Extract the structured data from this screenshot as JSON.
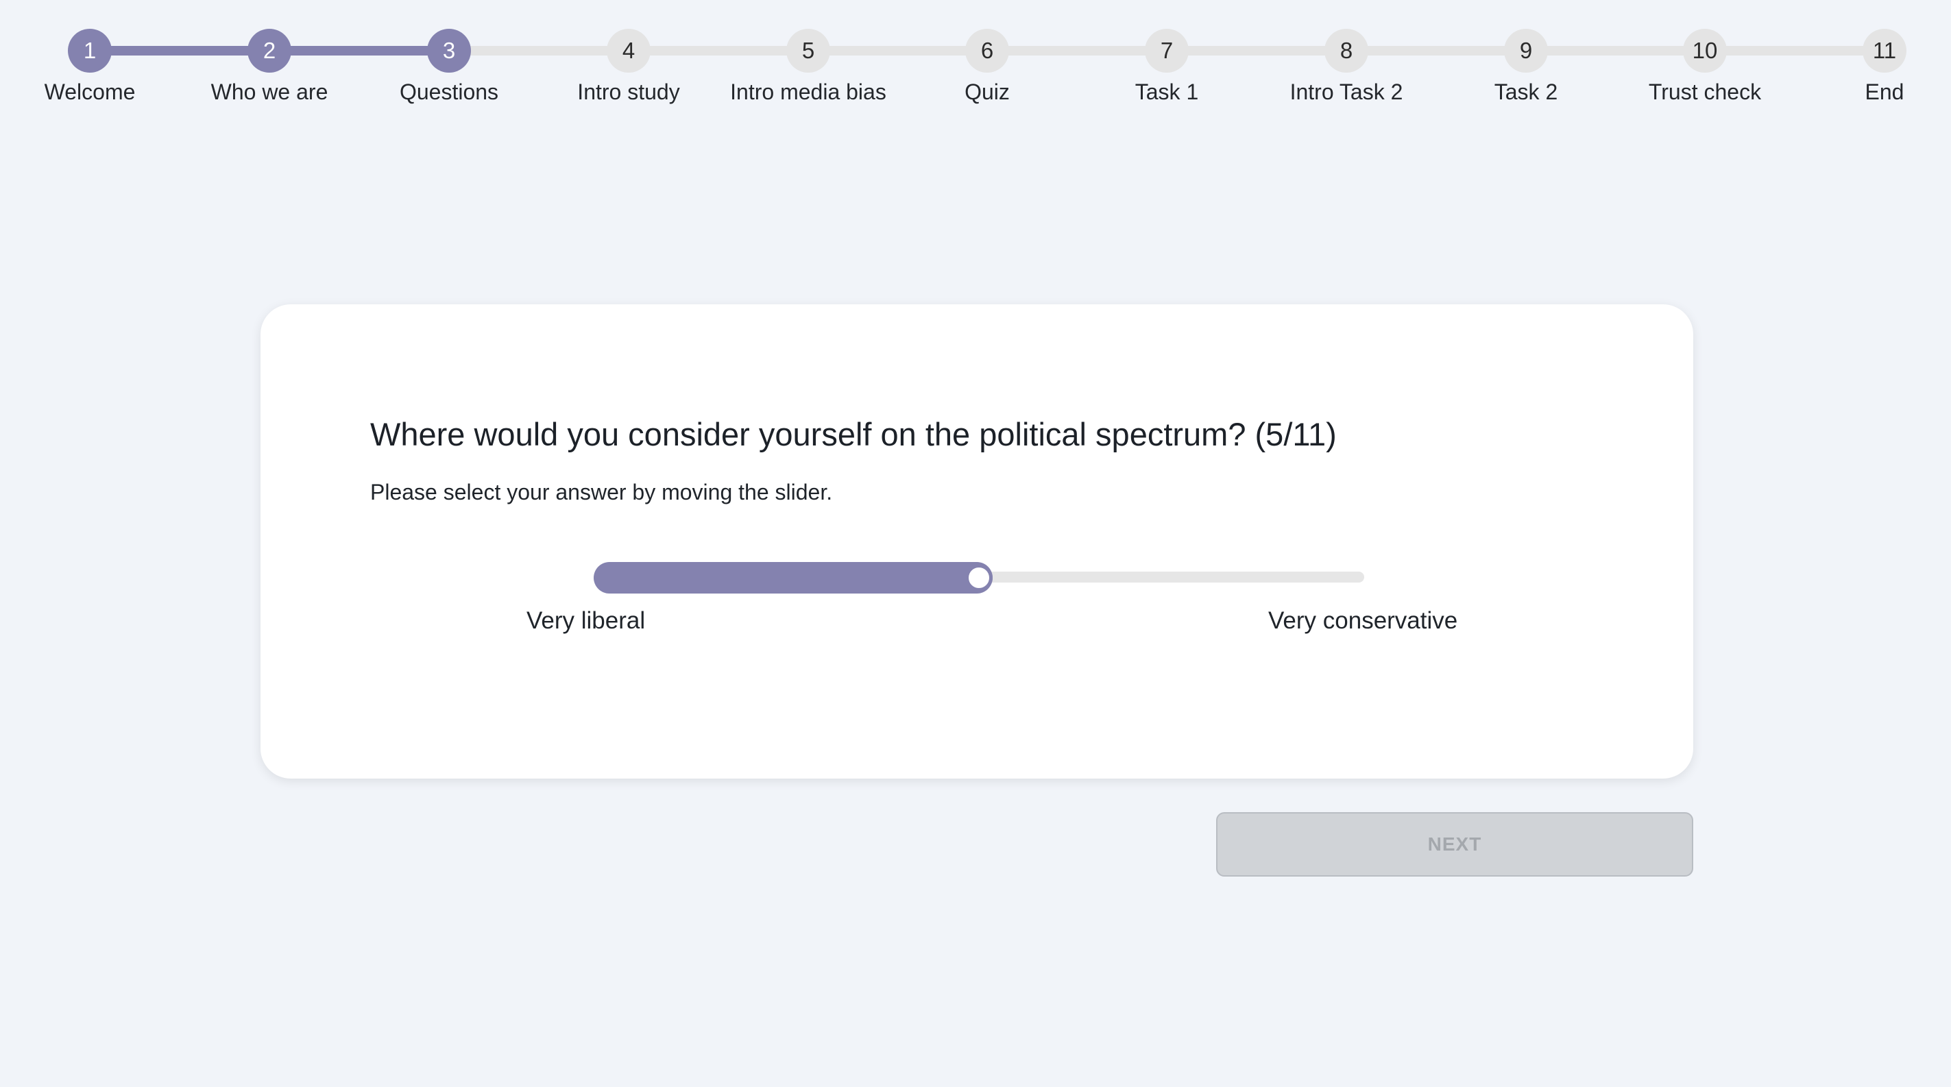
{
  "stepper": {
    "current_step": 3,
    "steps": [
      {
        "number": "1",
        "label": "Welcome"
      },
      {
        "number": "2",
        "label": "Who we are"
      },
      {
        "number": "3",
        "label": "Questions"
      },
      {
        "number": "4",
        "label": "Intro study"
      },
      {
        "number": "5",
        "label": "Intro media bias"
      },
      {
        "number": "6",
        "label": "Quiz"
      },
      {
        "number": "7",
        "label": "Task 1"
      },
      {
        "number": "8",
        "label": "Intro Task 2"
      },
      {
        "number": "9",
        "label": "Task 2"
      },
      {
        "number": "10",
        "label": "Trust check"
      },
      {
        "number": "11",
        "label": "End"
      }
    ]
  },
  "question": {
    "title": "Where would you consider yourself on the political spectrum? (5/11)",
    "hint": "Please select your answer by moving the slider.",
    "slider": {
      "value_fraction": 0.5,
      "min_label": "Very liberal",
      "max_label": "Very conservative"
    }
  },
  "navigation": {
    "next_label": "NEXT",
    "next_enabled": false
  },
  "colors": {
    "accent": "#8482af",
    "track": "#e4e4e4",
    "background": "#f1f4f9",
    "card": "#ffffff",
    "disabled_button": "#d0d3d7"
  }
}
